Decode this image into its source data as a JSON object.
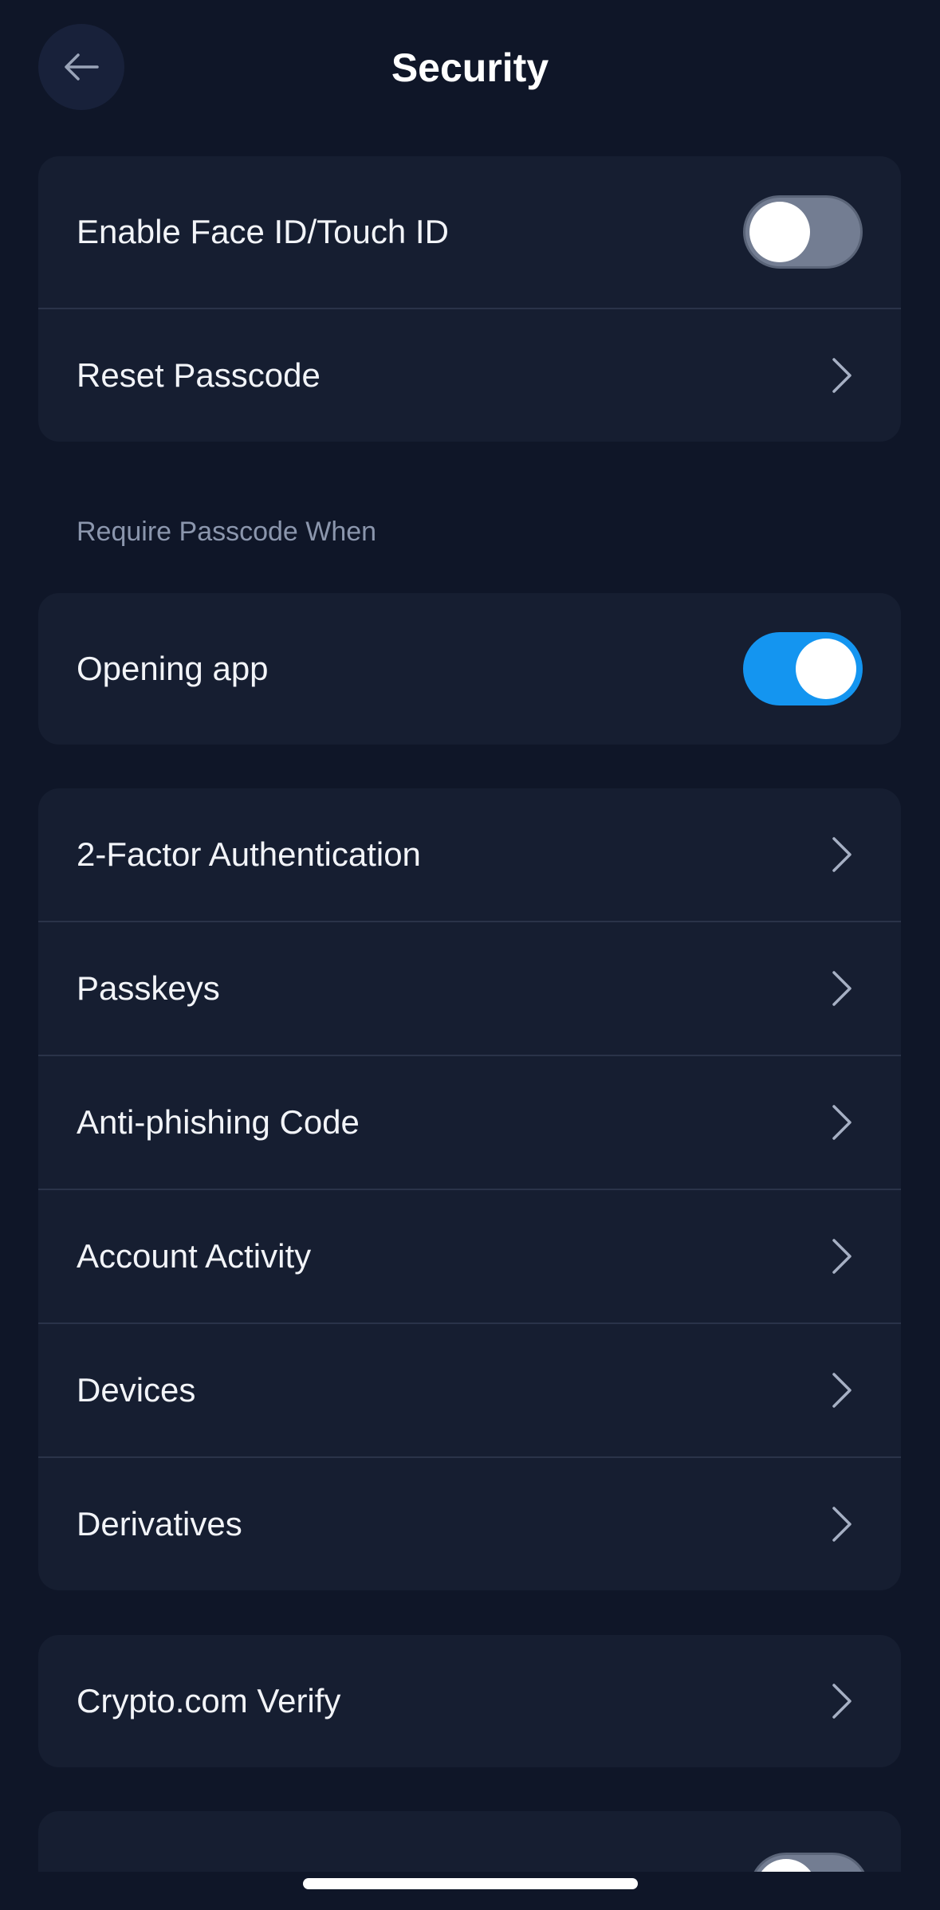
{
  "header": {
    "title": "Security"
  },
  "group_biometric": {
    "face_id_label": "Enable Face ID/Touch ID",
    "face_id_enabled": false,
    "reset_passcode_label": "Reset Passcode"
  },
  "section_require": {
    "label": "Require Passcode When",
    "opening_app_label": "Opening app",
    "opening_app_enabled": true
  },
  "group_security": {
    "items": [
      {
        "label": "2-Factor Authentication"
      },
      {
        "label": "Passkeys"
      },
      {
        "label": "Anti-phishing Code"
      },
      {
        "label": "Account Activity"
      },
      {
        "label": "Devices"
      },
      {
        "label": "Derivatives"
      }
    ]
  },
  "group_verify": {
    "label": "Crypto.com Verify"
  },
  "partial_row": {
    "toggle_enabled": false
  },
  "colors": {
    "background": "#0f1628",
    "card": "#161e31",
    "accent": "#1495f0",
    "toggle_off": "#737d92"
  }
}
